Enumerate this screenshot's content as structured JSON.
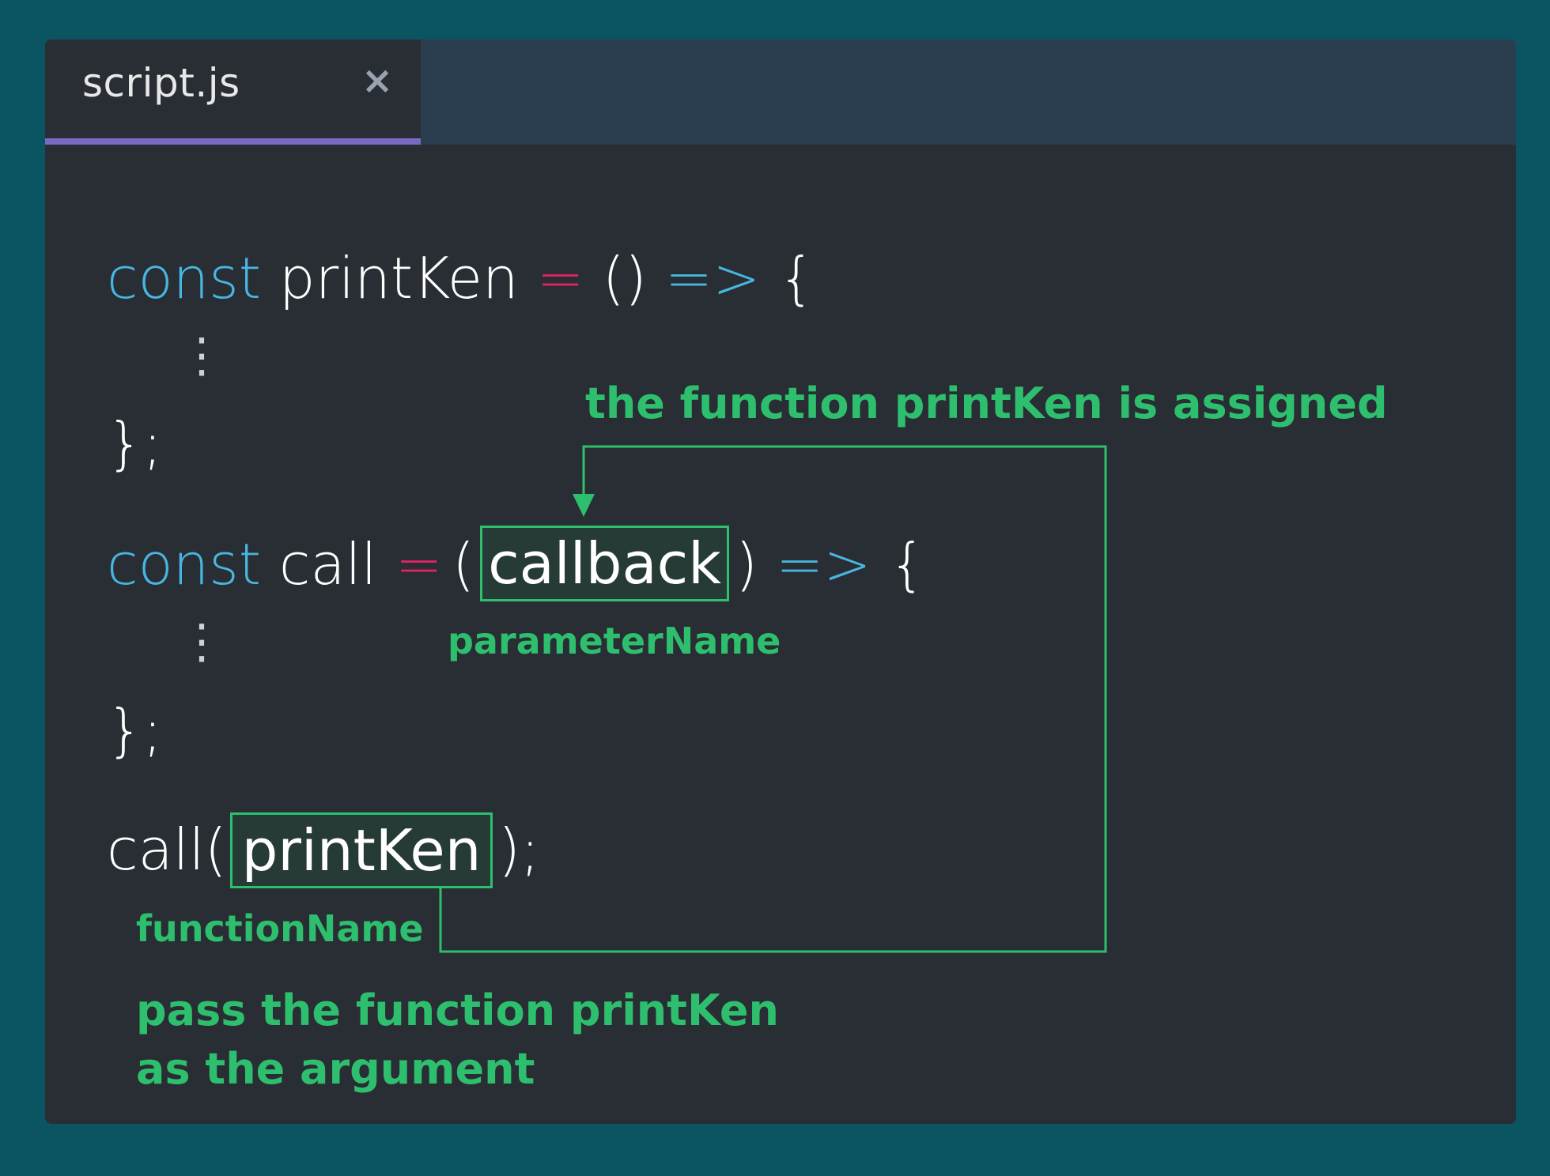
{
  "tab": {
    "title": "script.js",
    "close_symbol": "×"
  },
  "code": {
    "line1": {
      "kw": "const",
      "name": " printKen ",
      "eq": "=",
      "parens": " () ",
      "arrow": "=>",
      "brace": " {"
    },
    "dots": "⋮",
    "close1": "};",
    "line2": {
      "kw": "const",
      "name": " call ",
      "eq": "=",
      "open": "(",
      "param": "callback",
      "close": ")",
      "arrow": "=>",
      "brace": "{"
    },
    "close2": "};",
    "line3": {
      "fn": "call(",
      "arg": "printKen",
      "end": ");"
    }
  },
  "annotations": {
    "assigned": "the function printKen is assigned",
    "parameter_name": "parameterName",
    "function_name": "functionName",
    "pass_line1": "pass the function printKen",
    "pass_line2": "as the argument"
  },
  "colors": {
    "background": "#0b5563",
    "editor": "#292d34",
    "tabbar": "#2b3e4f",
    "tab_underline": "#7b68c3",
    "keyword": "#47b6e0",
    "operator": "#e0245e",
    "annotation": "#2ebf6e"
  }
}
